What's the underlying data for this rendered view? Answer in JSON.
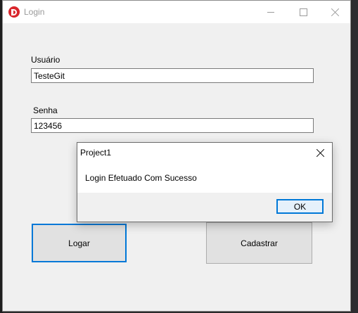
{
  "window": {
    "title": "Login"
  },
  "form": {
    "user_label": "Usuário",
    "user_value": "TesteGit",
    "pass_label": "Senha",
    "pass_value": "123456",
    "login_button": "Logar",
    "register_button": "Cadastrar"
  },
  "dialog": {
    "title": "Project1",
    "message": "Login Efetuado Com Sucesso",
    "ok_button": "OK"
  },
  "colors": {
    "accent": "#0078d7",
    "app_icon": "#d9262c"
  }
}
